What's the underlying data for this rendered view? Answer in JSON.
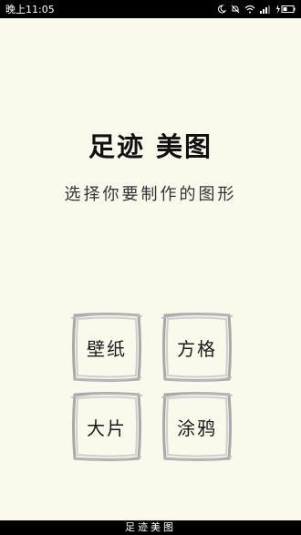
{
  "status_bar": {
    "time": "晚上11:05",
    "icons": [
      "moon-icon",
      "mute-bell-icon",
      "wifi-icon",
      "signal-icon",
      "battery-charging-icon"
    ]
  },
  "header": {
    "title": "足迹 美图",
    "subtitle": "选择你要制作的图形"
  },
  "options": [
    {
      "label": "壁纸"
    },
    {
      "label": "方格"
    },
    {
      "label": "大片"
    },
    {
      "label": "涂鸦"
    }
  ],
  "footer": {
    "label": "足迹美图"
  },
  "colors": {
    "background": "#fbf8ec",
    "frame": "#a8a8a8",
    "bars": "#000000"
  }
}
